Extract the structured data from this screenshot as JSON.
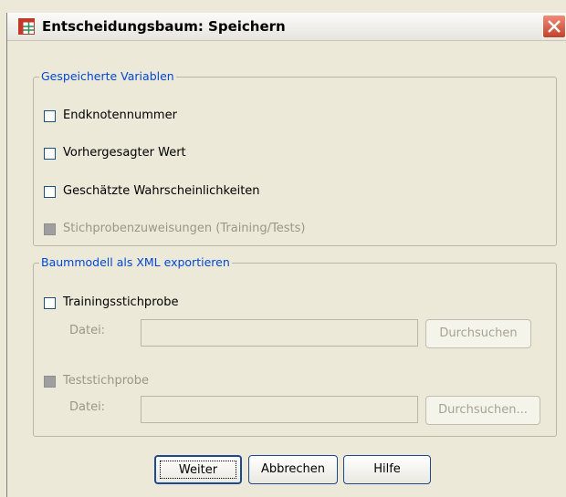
{
  "window": {
    "title": "Entscheidungsbaum: Speichern"
  },
  "saved_vars": {
    "legend": "Gespeicherte Variablen",
    "items": [
      {
        "label": "Endknotennummer",
        "checked": false,
        "enabled": true
      },
      {
        "label": "Vorhergesagter Wert",
        "checked": false,
        "enabled": true
      },
      {
        "label": "Geschätzte Wahrscheinlichkeiten",
        "checked": false,
        "enabled": true
      },
      {
        "label": "Stichprobenzuweisungen (Training/Tests)",
        "checked": false,
        "enabled": false
      }
    ]
  },
  "export_xml": {
    "legend": "Baummodell als XML exportieren",
    "training": {
      "label": "Trainingsstichprobe",
      "file_label": "Datei:",
      "file_value": "",
      "browse": "Durchsuchen"
    },
    "test": {
      "label": "Teststichprobe",
      "file_label": "Datei:",
      "file_value": "",
      "browse": "Durchsuchen..."
    }
  },
  "buttons": {
    "continue": "Weiter",
    "cancel": "Abbrechen",
    "help": "Hilfe"
  },
  "colors": {
    "legend": "#0046d5",
    "close_button": "#c4412a",
    "button_border": "#1d4a8c"
  },
  "icons": {
    "app": "grid-table-icon",
    "close": "close-icon"
  }
}
